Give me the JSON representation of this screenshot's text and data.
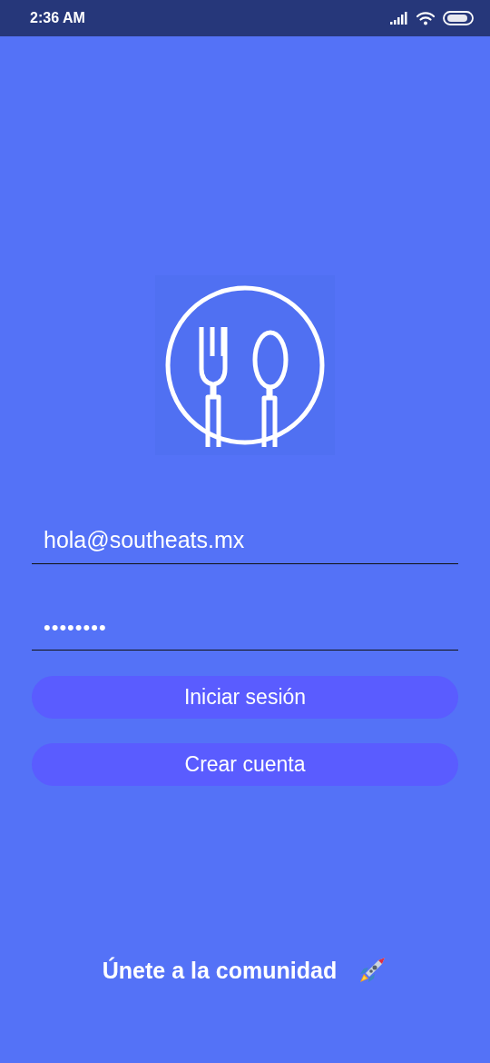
{
  "status_bar": {
    "time": "2:36 AM"
  },
  "email_field": {
    "value": "hola@southeats.mx"
  },
  "password_field": {
    "value": "••••••••"
  },
  "buttons": [
    {
      "label": "Iniciar sesión"
    },
    {
      "label": "Crear cuenta"
    }
  ],
  "footer": {
    "text": "Únete a la comunidad"
  }
}
